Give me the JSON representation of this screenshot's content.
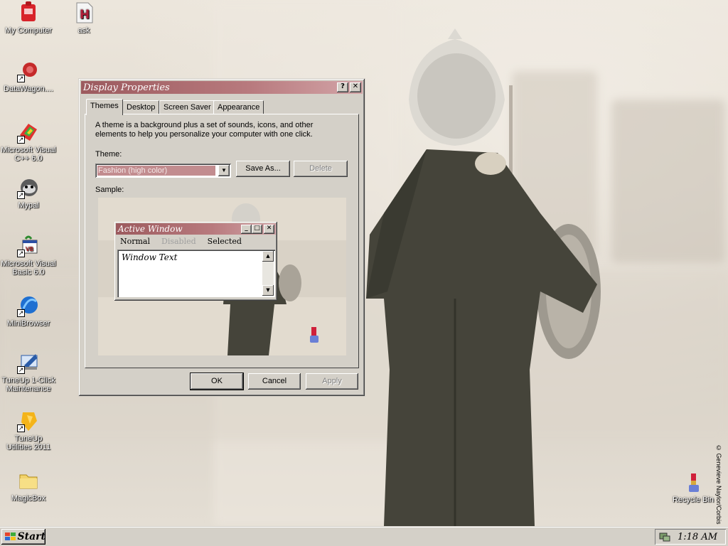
{
  "desktop": {
    "icons": [
      {
        "label": "My Computer",
        "icon": "my-computer-icon"
      },
      {
        "label": "ask",
        "icon": "ask-app-icon"
      },
      {
        "label": "DataWagon....",
        "icon": "datawagon-icon"
      },
      {
        "label": "Microsoft Visual\nC++ 6.0",
        "icon": "visual-cpp-icon"
      },
      {
        "label": "Mypal",
        "icon": "mypal-icon"
      },
      {
        "label": "Microsoft Visual\nBasic 6.0",
        "icon": "visual-basic-icon"
      },
      {
        "label": "MiniBrowser",
        "icon": "minibrowser-icon"
      },
      {
        "label": "TuneUp 1-Click\nMaintenance",
        "icon": "tuneup-maintenance-icon"
      },
      {
        "label": "TuneUp\nUtilities 2011",
        "icon": "tuneup-utilities-icon"
      },
      {
        "label": "MagicBox",
        "icon": "folder-icon"
      },
      {
        "label": "Recycle Bin",
        "icon": "recycle-bin-icon"
      }
    ],
    "copyright": "© Genevieve Naylor/Corbis"
  },
  "dialog": {
    "title": "Display Properties",
    "help_button": "?",
    "close_button": "✕",
    "tabs": [
      "Themes",
      "Desktop",
      "Screen Saver",
      "Appearance"
    ],
    "active_tab": "Themes",
    "description": "A theme is a background plus a set of sounds, icons, and other elements to help you personalize your computer with one click.",
    "theme_label": "Theme:",
    "theme_value": "Fashion (high color)",
    "save_as_label": "Save As...",
    "delete_label": "Delete",
    "sample_label": "Sample:",
    "sample_window": {
      "title": "Active Window",
      "menu": [
        "Normal",
        "Disabled",
        "Selected"
      ],
      "body_text": "Window Text"
    },
    "ok_label": "OK",
    "cancel_label": "Cancel",
    "apply_label": "Apply"
  },
  "taskbar": {
    "start_label": "Start",
    "clock": "1:18 AM"
  },
  "colors": {
    "titlebar_start": "#9c5a5e",
    "titlebar_end": "#d3a5a8",
    "face": "#d4d0c8"
  }
}
